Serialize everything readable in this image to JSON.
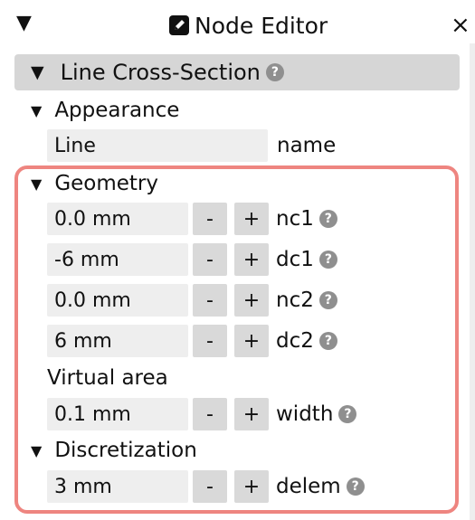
{
  "window": {
    "title": "Node Editor",
    "collapse_icon": "triangle-down-icon",
    "close_icon": "close-icon",
    "close_glyph": "×"
  },
  "section": {
    "title": "Line Cross-Section",
    "help_glyph": "?"
  },
  "appearance": {
    "heading": "Appearance",
    "name_value": "Line",
    "name_label": "name"
  },
  "geometry": {
    "heading": "Geometry",
    "rows": [
      {
        "value": "0.0 mm",
        "label": "nc1"
      },
      {
        "value": "-6 mm",
        "label": "dc1"
      },
      {
        "value": "0.0 mm",
        "label": "nc2"
      },
      {
        "value": "6 mm",
        "label": "dc2"
      }
    ],
    "virtual_area_label": "Virtual area",
    "width_value": "0.1 mm",
    "width_label": "width"
  },
  "discretization": {
    "heading": "Discretization",
    "delem_value": "3 mm",
    "delem_label": "delem"
  },
  "buttons": {
    "minus": "-",
    "plus": "+"
  },
  "colors": {
    "highlight_border": "#ee8580",
    "field_bg": "#eeeeee",
    "button_bg": "#d9d9d9",
    "header_bg": "#d6d6d6"
  }
}
